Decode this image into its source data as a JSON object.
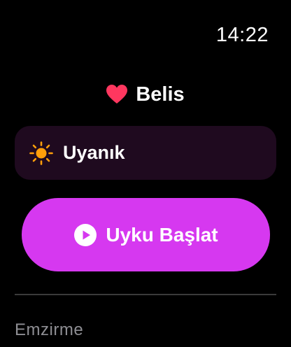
{
  "status_bar": {
    "time": "14:22"
  },
  "profile": {
    "name": "Belis",
    "icon": "heart-icon",
    "icon_color": "#ff375f"
  },
  "state_card": {
    "label": "Uyanık",
    "icon": "sun-icon",
    "icon_color": "#ff9f0a",
    "background": "#1f0a1f"
  },
  "primary_action": {
    "label": "Uyku Başlat",
    "icon": "play-circle-icon",
    "background": "#d638f0"
  },
  "sections": [
    {
      "label": "Emzirme"
    }
  ],
  "colors": {
    "background": "#000000",
    "text": "#ffffff",
    "secondary_text": "#8e8e93",
    "divider": "#3a3a3a"
  }
}
